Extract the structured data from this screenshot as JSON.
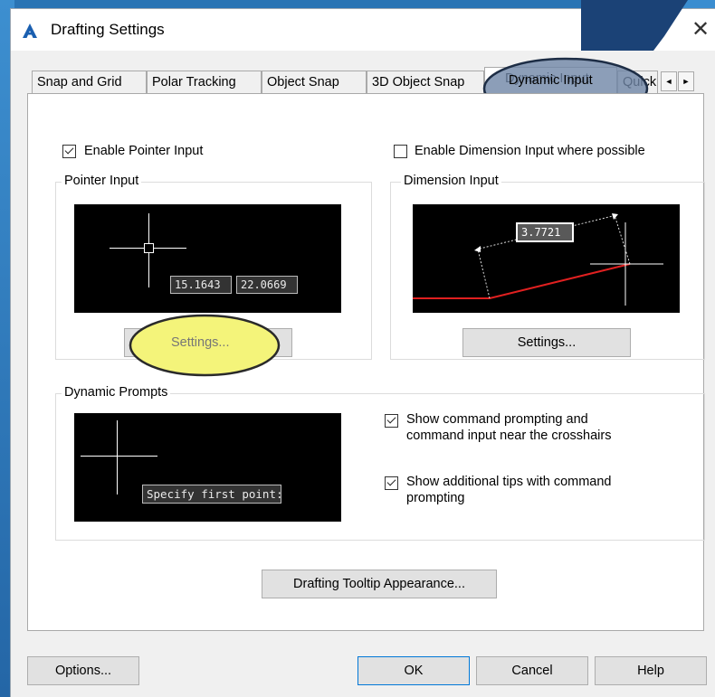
{
  "window": {
    "title": "Drafting Settings",
    "close_glyph": "✕",
    "app_icon": "autocad-a-icon"
  },
  "tabs": [
    {
      "label": "Snap and Grid"
    },
    {
      "label": "Polar Tracking"
    },
    {
      "label": "Object Snap"
    },
    {
      "label": "3D Object Snap"
    },
    {
      "label": "Dynamic Input",
      "active": true
    },
    {
      "label": "Quick Properties"
    }
  ],
  "tab_scroll": {
    "left": "◄",
    "right": "►"
  },
  "pointer": {
    "enable_label": "Enable Pointer Input",
    "enable_checked": true,
    "group_title": "Pointer Input",
    "coord_x": "15.1643",
    "coord_y": "22.0669",
    "settings_label": "Settings..."
  },
  "dimension": {
    "enable_label": "Enable Dimension Input where possible",
    "enable_checked": false,
    "group_title": "Dimension Input",
    "value": "3.7721",
    "settings_label": "Settings..."
  },
  "prompts": {
    "group_title": "Dynamic Prompts",
    "preview_text": "Specify first point:",
    "show_command_label_1": "Show command prompting and",
    "show_command_label_2": "command input near the crosshairs",
    "show_command_checked": true,
    "show_tips_label_1": "Show additional tips with command",
    "show_tips_label_2": "prompting",
    "show_tips_checked": true
  },
  "tooltip_appearance_label": "Drafting Tooltip Appearance...",
  "footer": {
    "options": "Options...",
    "ok": "OK",
    "cancel": "Cancel",
    "help": "Help"
  },
  "colors": {
    "highlight_yellow": "#f4f47a",
    "highlight_blue": "#6f86a6",
    "accent": "#0078d7",
    "brand_navy": "#1b4276"
  }
}
